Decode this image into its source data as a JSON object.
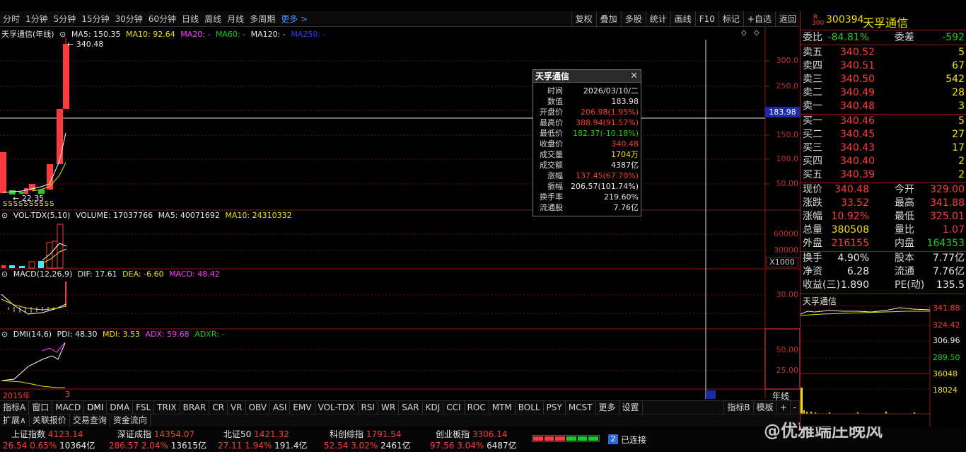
{
  "top_tabs": [
    "分时",
    "1分钟",
    "5分钟",
    "15分钟",
    "30分钟",
    "60分钟",
    "日线",
    "周线",
    "月线",
    "多周期",
    "更多 >"
  ],
  "tool_buttons": [
    "复权",
    "叠加",
    "多股",
    "统计",
    "画线",
    "F10",
    "标记",
    "+自选",
    "返回"
  ],
  "kline_info": {
    "name": "天孚通信(年线)",
    "ma5": "MA5: 150.35",
    "ma10": "MA10: 92.64",
    "ma20": "MA20: -",
    "ma60": "MA60: -",
    "ma120": "MA120: -",
    "ma250": "MA250: -"
  },
  "price_axis": [
    "300.0",
    "250.0",
    "200.0",
    "150.0",
    "100.0",
    "50.00"
  ],
  "high_label": "340.48",
  "low_label": "22.35",
  "cursor_value": "183.98",
  "vol_info": {
    "name": "VOL-TDX(5,10)",
    "volume": "VOLUME: 17037766",
    "ma5": "MA5: 40071692",
    "ma10": "MA10: 24310332"
  },
  "vol_axis": [
    "60000",
    "30000",
    "X1000"
  ],
  "macd_info": {
    "name": "MACD(12,26,9)",
    "dif": "DIF: 17.61",
    "dea": "DEA: -6.60",
    "macd": "MACD: 48.42"
  },
  "macd_axis": [
    "30.00"
  ],
  "dmi_info": {
    "name": "DMI(14,6)",
    "pdi": "PDI: 48.30",
    "mdi": "MDI: 3.53",
    "adx": "ADX: 59.68",
    "adxr": "ADXR: -"
  },
  "dmi_axis": [
    "50.00",
    "25.00"
  ],
  "date_start": "2015年",
  "date_mark": "3",
  "period_label": "年线",
  "tooltip": {
    "title": "天孚通信",
    "rows": [
      {
        "k": "时间",
        "v": "2026/03/10/二"
      },
      {
        "k": "数值",
        "v": "183.98"
      },
      {
        "k": "开盘价",
        "v": "206.98(1.95%)"
      },
      {
        "k": "最高价",
        "v": "388.94(91.57%)"
      },
      {
        "k": "最低价",
        "v": "182.37(-10.18%)"
      },
      {
        "k": "收盘价",
        "v": "340.48"
      },
      {
        "k": "成交量",
        "v": "1704万"
      },
      {
        "k": "成交额",
        "v": "4387亿"
      },
      {
        "k": "涨幅",
        "v": "137.45(67.70%)"
      },
      {
        "k": "振幅",
        "v": "206.57(101.74%)"
      },
      {
        "k": "换手率",
        "v": "219.60%"
      },
      {
        "k": "流通股",
        "v": "7.76亿"
      }
    ]
  },
  "indicator_tabs": [
    "指标A",
    "窗口",
    "MACD",
    "DMI",
    "DMA",
    "FSL",
    "TRIX",
    "BRAR",
    "CR",
    "VR",
    "OBV",
    "ASI",
    "EMV",
    "VOL-TDX",
    "RSI",
    "WR",
    "SAR",
    "KDJ",
    "CCI",
    "ROC",
    "MTM",
    "BOLL",
    "PSY",
    "MCST",
    "更多",
    "设置"
  ],
  "indicator_right": [
    "指标B",
    "模板",
    "+",
    "-"
  ],
  "func_tabs": [
    "扩展∧",
    "关联报价",
    "交易查询",
    "资金流向"
  ],
  "indices": [
    {
      "name": "上证指数",
      "price": "4123.14",
      "chg": "26.54",
      "pct": "0.65%",
      "amt": "10364亿",
      "color": "red"
    },
    {
      "name": "深证成指",
      "price": "14354.07",
      "chg": "286.57",
      "pct": "2.04%",
      "amt": "13615亿",
      "color": "red"
    },
    {
      "name": "北证50",
      "price": "1421.32",
      "chg": "27.11",
      "pct": "1.94%",
      "amt": "191.4亿",
      "color": "red"
    },
    {
      "name": "科创综指",
      "price": "1791.54",
      "chg": "52.54",
      "pct": "3.02%",
      "amt": "2461亿",
      "color": "red"
    },
    {
      "name": "创业板指",
      "price": "3306.14",
      "chg": "97.56",
      "pct": "3.04%",
      "amt": "6487亿",
      "color": "red"
    }
  ],
  "connection": "已连接",
  "connection_num": "2",
  "stock": {
    "code": "300394",
    "name": "天孚通信",
    "tag_r": "R",
    "tag_300": "300"
  },
  "weibi": {
    "label": "委比",
    "value": "-84.81%",
    "label2": "委差",
    "value2": "-592"
  },
  "asks": [
    {
      "label": "卖五",
      "price": "340.52",
      "vol": "5"
    },
    {
      "label": "卖四",
      "price": "340.51",
      "vol": "67"
    },
    {
      "label": "卖三",
      "price": "340.50",
      "vol": "542"
    },
    {
      "label": "卖二",
      "price": "340.49",
      "vol": "28"
    },
    {
      "label": "卖一",
      "price": "340.48",
      "vol": "3"
    }
  ],
  "bids": [
    {
      "label": "买一",
      "price": "340.46",
      "vol": "5"
    },
    {
      "label": "买二",
      "price": "340.45",
      "vol": "27"
    },
    {
      "label": "买三",
      "price": "340.43",
      "vol": "17"
    },
    {
      "label": "买四",
      "price": "340.40",
      "vol": "2"
    },
    {
      "label": "买五",
      "price": "340.39",
      "vol": "2"
    }
  ],
  "quote": [
    {
      "l1": "现价",
      "v1": "340.48",
      "c1": "red",
      "l2": "今开",
      "v2": "329.00",
      "c2": "red"
    },
    {
      "l1": "涨跌",
      "v1": "33.52",
      "c1": "red",
      "l2": "最高",
      "v2": "341.88",
      "c2": "red"
    },
    {
      "l1": "涨幅",
      "v1": "10.92%",
      "c1": "red",
      "l2": "最低",
      "v2": "325.01",
      "c2": "red"
    },
    {
      "l1": "总量",
      "v1": "380508",
      "c1": "yellow",
      "l2": "量比",
      "v2": "1.07",
      "c2": "red"
    },
    {
      "l1": "外盘",
      "v1": "216155",
      "c1": "red",
      "l2": "内盘",
      "v2": "164353",
      "c2": "green"
    }
  ],
  "fund": [
    {
      "l1": "换手",
      "v1": "4.90%",
      "l2": "股本",
      "v2": "7.77亿"
    },
    {
      "l1": "净资",
      "v1": "6.28",
      "l2": "流通",
      "v2": "7.76亿"
    },
    {
      "l1": "收益(三)",
      "v1": "1.890",
      "l2": "PE(动)",
      "v2": "135.5"
    }
  ],
  "mini_chart": {
    "title": "天孚通信",
    "prices": [
      "341.88",
      "324.42",
      "306.96",
      "289.50"
    ],
    "vols": [
      "36048",
      "18024"
    ]
  },
  "watermark": "@优雅端庄晚风",
  "colors": {
    "up": "#ff3b3b",
    "down": "#1ecb1e",
    "grid": "#8c1c1c",
    "ma5": "#ffffff",
    "ma10": "#f0e000",
    "ma20": "#ff3cff",
    "ma60": "#1ecb1e",
    "ma120": "#c8c8c8",
    "ma250": "#3a3aff"
  }
}
